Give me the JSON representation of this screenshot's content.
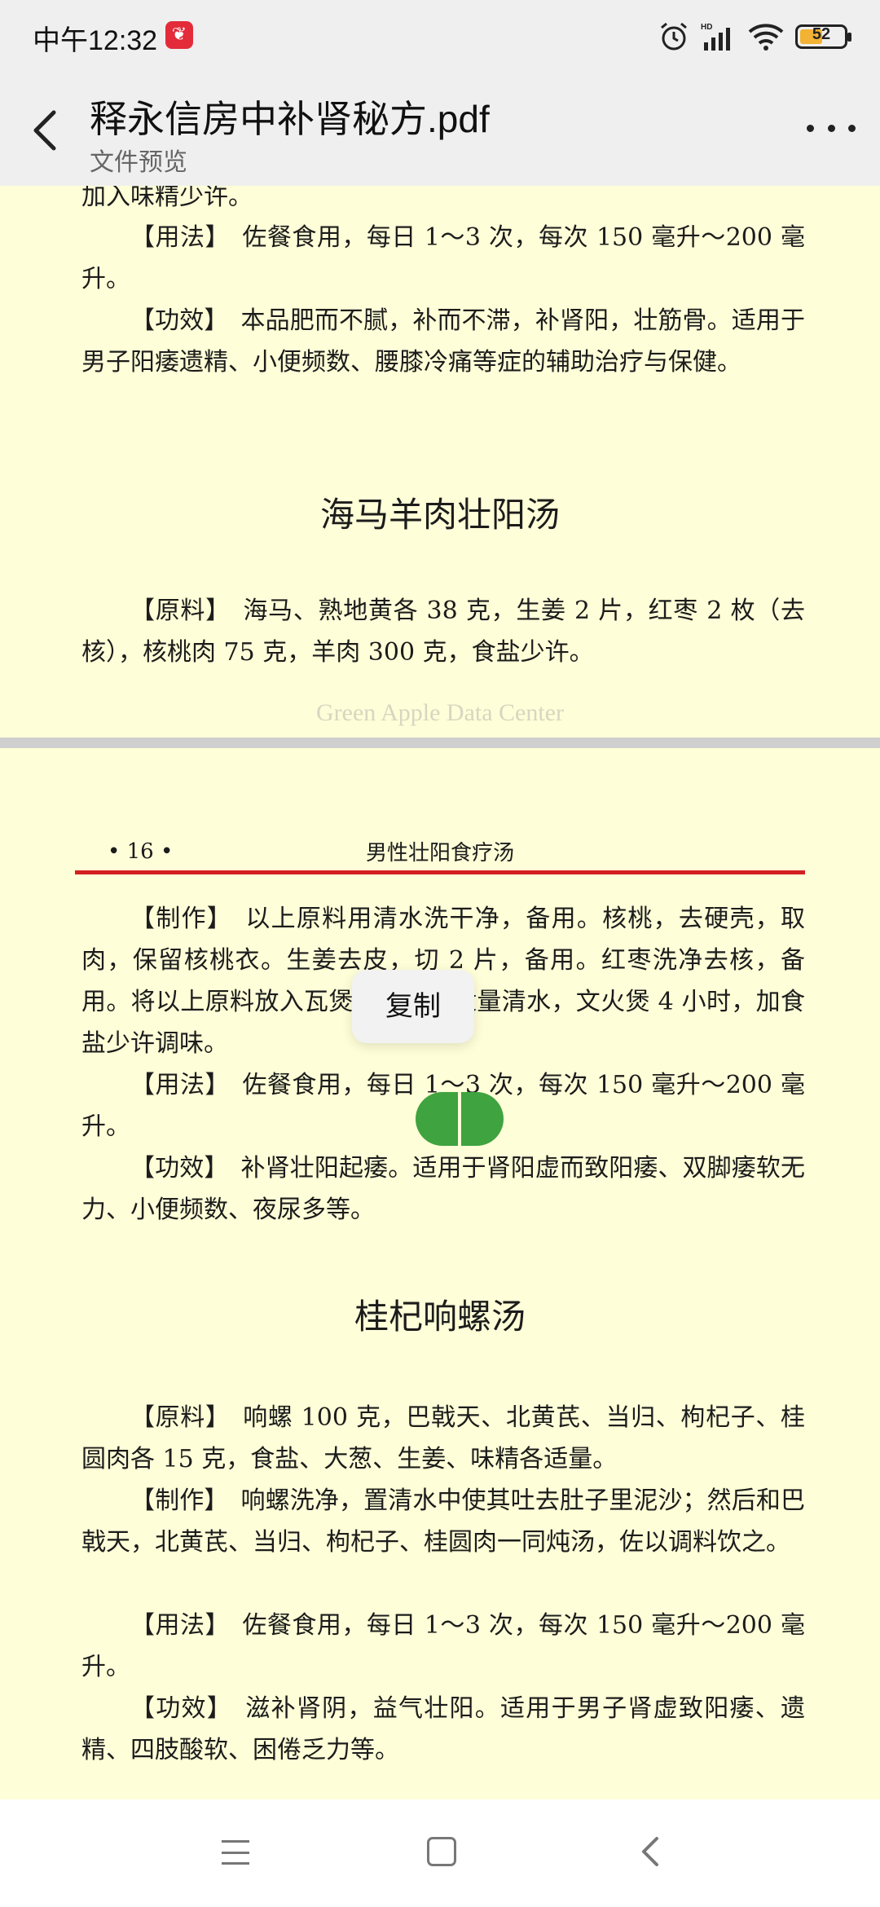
{
  "status_bar": {
    "time": "中午12:32",
    "battery": "52",
    "battery_level": 0.52
  },
  "header": {
    "title": "释永信房中补肾秘方.pdf",
    "subtitle": "文件预览"
  },
  "page1": {
    "lines": [
      "加入味精少许。",
      "【用法】　佐餐食用，每日 1～3 次，每次 150 毫升～200 毫升。",
      "【功效】　本品肥而不腻，补而不滞，补肾阳，壮筋骨。适用于男子阳痿遗精、小便频数、腰膝冷痛等症的辅助治疗与保健。"
    ],
    "heading": "海马羊肉壮阳汤",
    "ingredients": "【原料】　海马、熟地黄各 38 克，生姜 2 片，红枣 2 枚（去核），核桃肉 75 克，羊肉 300 克，食盐少许。",
    "watermark": "Green Apple Data Center"
  },
  "page2": {
    "page_number": "• 16 •",
    "running_title": "男性壮阳食疗汤",
    "p1": "【制作】　以上原料用清水洗干净，备用。核桃，去硬壳，取肉，保留核桃衣。生姜去皮，切 2 片，备用。红枣洗净去核，备用。将以上原料放入瓦煲内，加入适量清水，文火煲 4 小时，加食盐少许调味。",
    "p2": "【用法】　佐餐食用，每日 1～3 次，每次 150 毫升～200 毫升。",
    "p3": "【功效】　补肾壮阳起痿。适用于肾阳虚而致阳痿、双脚痿软无力、小便频数、夜尿多等。",
    "heading": "桂杞响螺汤",
    "p4": "【原料】　响螺 100 克，巴戟天、北黄芪、当归、枸杞子、桂圆肉各 15 克，食盐、大葱、生姜、味精各适量。",
    "p5": "【制作】　响螺洗净，置清水中使其吐去肚子里泥沙；然后和巴戟天，北黄芪、当归、枸杞子、桂圆肉一同炖汤，佐以调料饮之。",
    "p6": "【用法】　佐餐食用，每日 1～3 次，每次 150 毫升～200 毫升。",
    "p7": "【功效】　滋补肾阴，益气壮阳。适用于男子肾虚致阳痿、遗精、四肢酸软、困倦乏力等。"
  },
  "selection": {
    "copy_label": "复制"
  }
}
